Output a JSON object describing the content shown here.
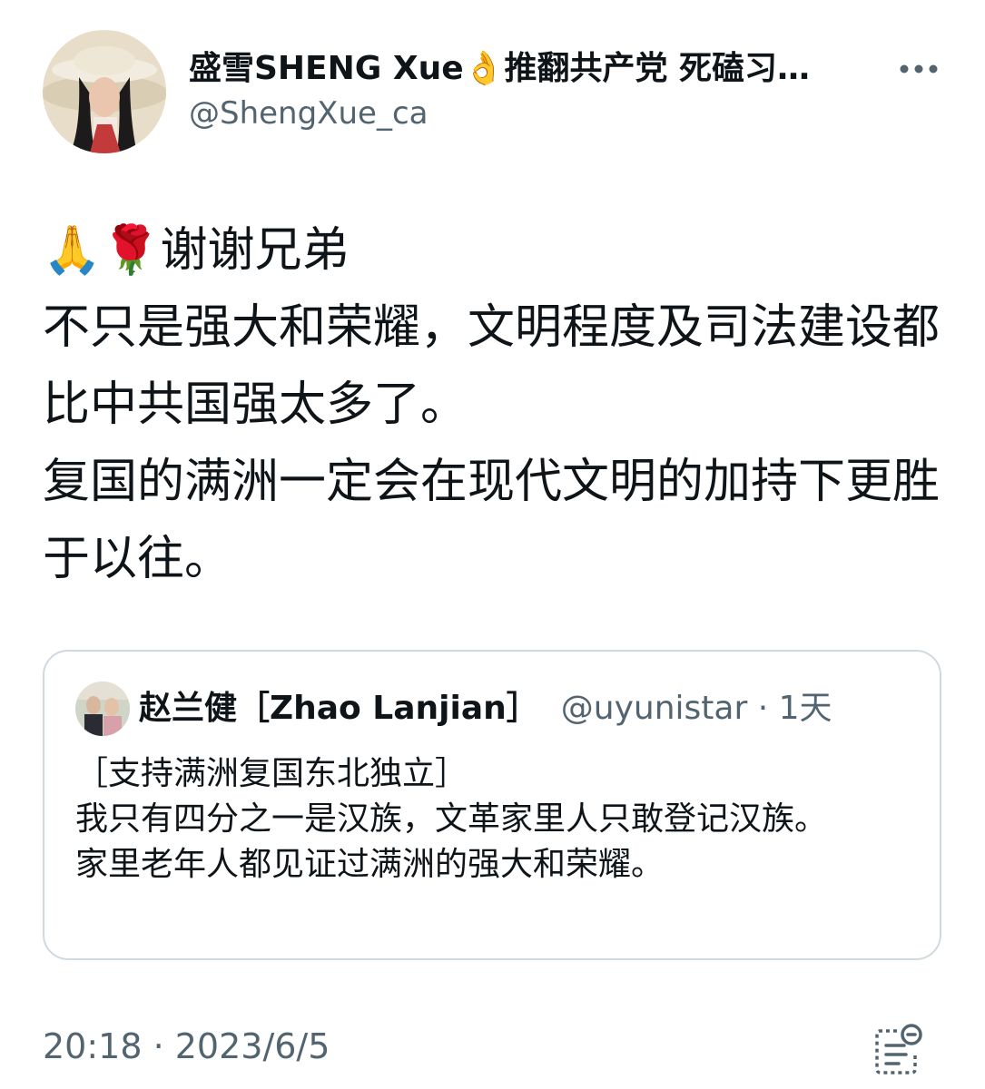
{
  "author": {
    "display_name": "盛雪SHENG Xue👌推翻共产党 死磕习…",
    "handle": "@ShengXue_ca"
  },
  "tweet": {
    "text": "🙏🌹谢谢兄弟\n不只是强大和荣耀，文明程度及司法建设都比中共国强太多了。\n复国的满洲一定会在现代文明的加持下更胜于以往。"
  },
  "quoted_tweet": {
    "display_name": "赵兰健［Zhao Lanjian］",
    "handle_time": "@uyunistar · 1天",
    "text": "［支持满洲复国东北独立］\n我只有四分之一是汉族，文革家里人只敢登记汉族。\n家里老年人都见证过满洲的强大和荣耀。"
  },
  "timestamp": "20:18 · 2023/6/5",
  "icons": {
    "more": "more-horizontal-icon",
    "summary": "post-summary-icon"
  },
  "colors": {
    "text": "#0f1419",
    "secondary": "#536471",
    "border": "#cfd9de"
  }
}
